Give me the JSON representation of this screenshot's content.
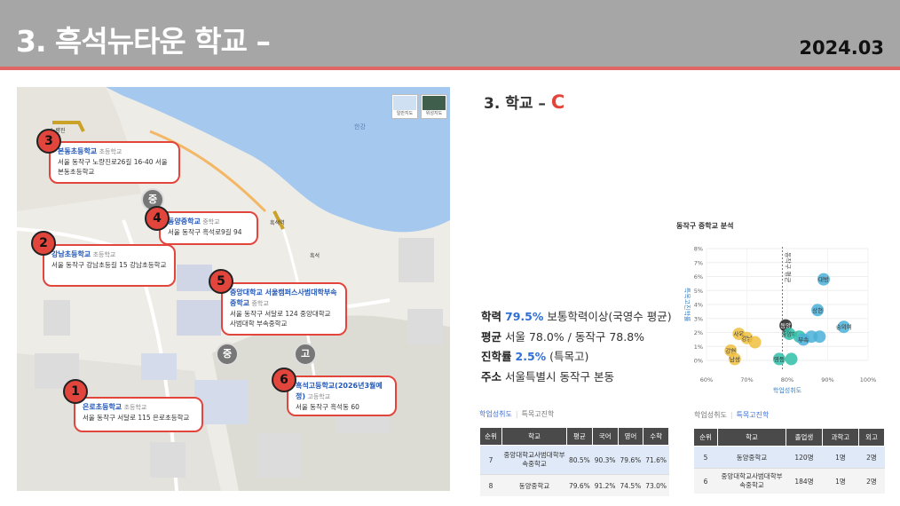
{
  "header": {
    "title": "3. 흑석뉴타운 학교 –",
    "date": "2024.03"
  },
  "map": {
    "buttons": [
      {
        "label": "일반지도"
      },
      {
        "label": "위성지도"
      }
    ],
    "schools": [
      {
        "num": "3",
        "name": "본동초등학교",
        "type": "초등학교",
        "addr": "서울 동작구 노량진로26길 16-40 서울본동초등학교"
      },
      {
        "num": "4",
        "name": "동양중학교",
        "type": "중학교",
        "addr": "서울 동작구 흑석로9길 94"
      },
      {
        "num": "2",
        "name": "강남초등학교",
        "type": "초등학교",
        "addr": "서울 동작구 강남초등길 15 강남초등학교"
      },
      {
        "num": "5",
        "name": "중앙대학교 서울캠퍼스사범대학부속중학교",
        "type": "중학교",
        "addr": "서울 동작구 서달로 124 중앙대학교 사범대학 부속중학교"
      },
      {
        "num": "1",
        "name": "은로초등학교",
        "type": "초등학교",
        "addr": "서울 동작구 서달로 115 은로초등학교"
      },
      {
        "num": "6",
        "name": "흑석고등학교(2026년3월예정)",
        "type": "고등학교",
        "addr": "서울 동작구 흑석동 60"
      }
    ],
    "zones": [
      "중",
      "중",
      "고"
    ],
    "labels": {
      "station": "흑석역",
      "river_a": "한강",
      "place_a": "노량진",
      "place_b": "흑석"
    }
  },
  "section": {
    "title": "3. 학교 – ",
    "letter": "C"
  },
  "stats": {
    "l1a": "학력",
    "l1b": "79.5%",
    "l1c": "보통학력이상(국영수 평균)",
    "l2a": "평균",
    "l2b": "서울 78.0% / 동작구 78.8%",
    "l3a": "진학률",
    "l3b": "2.5%",
    "l3c": "(특목고)",
    "l4a": "주소",
    "l4b": "서울특별시 동작구 본동"
  },
  "chart_data": {
    "type": "scatter",
    "title": "동작구 중학교 분석",
    "xlabel": "학업성취도",
    "ylabel": "특목고진학률",
    "xlim": [
      60,
      100
    ],
    "ylim": [
      0,
      8
    ],
    "xticks": [
      "60%",
      "70%",
      "80%",
      "90%",
      "100%"
    ],
    "yticks": [
      "0%",
      "1%",
      "2%",
      "3%",
      "4%",
      "5%",
      "6%",
      "7%",
      "8%"
    ],
    "reference_label": "동작구 평균",
    "reference_x": 78.8,
    "points": [
      {
        "x": 89,
        "y": 5.8,
        "label": "대방",
        "color": "#4ab0d8"
      },
      {
        "x": 87.5,
        "y": 3.6,
        "label": "상현",
        "color": "#4ab0d8"
      },
      {
        "x": 94,
        "y": 2.4,
        "label": "숭의여",
        "color": "#4ab0d8"
      },
      {
        "x": 79.6,
        "y": 2.5,
        "label": "동양",
        "color": "#222222"
      },
      {
        "x": 80.5,
        "y": 1.9,
        "label": "중앙대",
        "color": "#2fbfa8"
      },
      {
        "x": 83,
        "y": 1.7,
        "label": "",
        "color": "#2fbfa8"
      },
      {
        "x": 86,
        "y": 1.7,
        "label": "",
        "color": "#4ab0d8"
      },
      {
        "x": 88,
        "y": 1.7,
        "label": "",
        "color": "#4ab0d8"
      },
      {
        "x": 84,
        "y": 1.5,
        "label": "부속",
        "color": "#4ab0d8"
      },
      {
        "x": 68,
        "y": 1.9,
        "label": "사육",
        "color": "#f0c040"
      },
      {
        "x": 70,
        "y": 1.6,
        "label": "강남",
        "color": "#f0c040"
      },
      {
        "x": 72,
        "y": 1.3,
        "label": "",
        "color": "#f0c040"
      },
      {
        "x": 66,
        "y": 0.7,
        "label": "강현",
        "color": "#f0c040"
      },
      {
        "x": 67,
        "y": 0.1,
        "label": "남성",
        "color": "#f0c040"
      },
      {
        "x": 78,
        "y": 0.1,
        "label": "영등",
        "color": "#2fbfa8"
      },
      {
        "x": 81,
        "y": 0.1,
        "label": "",
        "color": "#2fbfa8"
      }
    ]
  },
  "tabs_left": {
    "a": "학업성취도",
    "b": "특목고진학"
  },
  "tabs_right": {
    "a": "학업성취도",
    "b": "특목고진학"
  },
  "table_left": {
    "headers": [
      "순위",
      "학교",
      "평균",
      "국어",
      "영어",
      "수학"
    ],
    "rows": [
      [
        "7",
        "중앙대학교사범대학부속중학교",
        "80.5%",
        "90.3%",
        "79.6%",
        "71.6%"
      ],
      [
        "8",
        "동양중학교",
        "79.6%",
        "91.2%",
        "74.5%",
        "73.0%"
      ]
    ]
  },
  "table_right": {
    "headers": [
      "순위",
      "학교",
      "졸업생",
      "과학고",
      "외고"
    ],
    "rows": [
      [
        "5",
        "동양중학교",
        "120명",
        "1명",
        "2명"
      ],
      [
        "6",
        "중앙대학교사범대학부속중학교",
        "184명",
        "1명",
        "2명"
      ]
    ]
  }
}
